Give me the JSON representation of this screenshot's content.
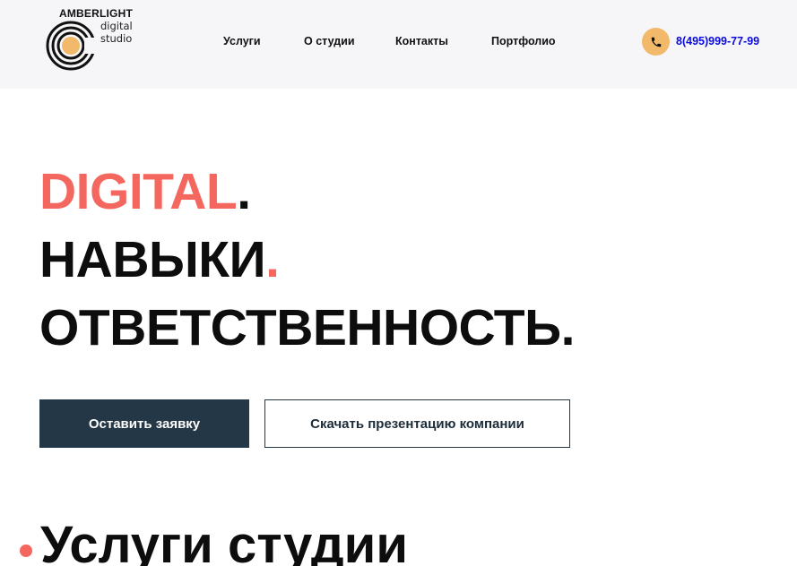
{
  "brand": {
    "name": "AMBERLIGHT",
    "sub_line1": "digital",
    "sub_line2": "studio"
  },
  "nav": {
    "items": [
      {
        "label": "Услуги"
      },
      {
        "label": "О студии"
      },
      {
        "label": "Контакты"
      },
      {
        "label": "Портфолио"
      }
    ]
  },
  "contact": {
    "phone": "8(495)999-77-99",
    "icon": "phone-icon"
  },
  "hero": {
    "line1_word": "DIGITAL",
    "line1_dot": ".",
    "line2_word": "НАВЫКИ",
    "line2_dot": ".",
    "line3_word": "ОТВЕТСТВЕННОСТЬ.",
    "buttons": {
      "primary_label": "Оставить заявку",
      "secondary_label": "Скачать презентацию компании"
    }
  },
  "services": {
    "title": "Услуги студии"
  },
  "colors": {
    "accent": "#f4675f",
    "primary_button": "#243746",
    "phone_badge": "#f2b96a",
    "phone_link": "#0a0ae0",
    "header_bg": "#f6f6f8"
  }
}
